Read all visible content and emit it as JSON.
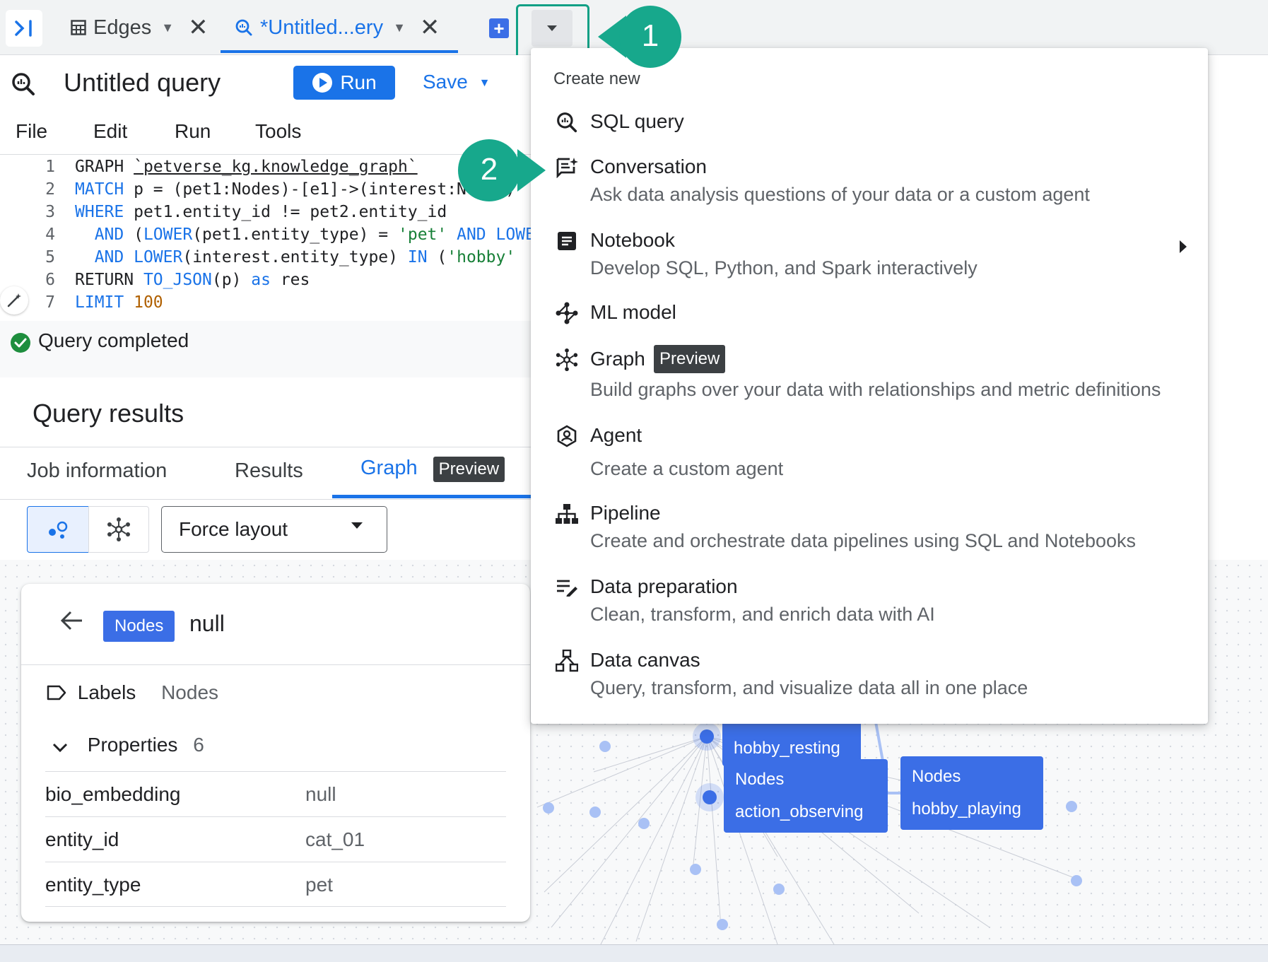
{
  "tabs": {
    "edges_label": "Edges",
    "query_label": "*Untitled...ery"
  },
  "query": {
    "title": "Untitled query",
    "run_label": "Run",
    "save_label": "Save",
    "menu": [
      "File",
      "Edit",
      "Run",
      "Tools"
    ]
  },
  "editor": {
    "line_numbers": [
      "1",
      "2",
      "3",
      "4",
      "5",
      "6",
      "7"
    ]
  },
  "status": {
    "text": "Query completed"
  },
  "results": {
    "title": "Query results",
    "tabs": [
      "Job information",
      "Results",
      "Graph"
    ],
    "preview_badge": "Preview",
    "layout_select": "Force layout"
  },
  "panel": {
    "badge": "Nodes",
    "name": "null",
    "labels_key": "Labels",
    "labels_value": "Nodes",
    "properties_label": "Properties",
    "properties_count": "6",
    "properties": [
      {
        "key": "bio_embedding",
        "value": "null"
      },
      {
        "key": "entity_id",
        "value": "cat_01"
      },
      {
        "key": "entity_type",
        "value": "pet"
      }
    ]
  },
  "graph_nodes": {
    "n1_type": "Nodes",
    "n1_name": "hobby_resting",
    "n2_type": "Nodes",
    "n2_name": "action_observing",
    "n3_type": "Nodes",
    "n3_name": "hobby_playing"
  },
  "callouts": {
    "one": "1",
    "two": "2"
  },
  "dropdown_menu": {
    "heading": "Create new",
    "items": [
      {
        "title": "SQL query",
        "desc": "",
        "icon": "sql-query-icon"
      },
      {
        "title": "Conversation",
        "desc": "Ask data analysis questions of your data or a custom agent",
        "icon": "conversation-icon"
      },
      {
        "title": "Notebook",
        "desc": "Develop SQL, Python, and Spark interactively",
        "icon": "notebook-icon"
      },
      {
        "title": "ML model",
        "desc": "",
        "icon": "ml-model-icon"
      },
      {
        "title": "Graph",
        "desc": "Build graphs over your data with relationships and metric definitions",
        "icon": "graph-icon",
        "badge": "Preview"
      },
      {
        "title": "Agent",
        "desc": "Create a custom agent",
        "icon": "agent-icon"
      },
      {
        "title": "Pipeline",
        "desc": "Create and orchestrate data pipelines using SQL and Notebooks",
        "icon": "pipeline-icon"
      },
      {
        "title": "Data preparation",
        "desc": "Clean, transform, and enrich data with AI",
        "icon": "data-preparation-icon"
      },
      {
        "title": "Data canvas",
        "desc": "Query, transform, and visualize data all in one place",
        "icon": "data-canvas-icon"
      }
    ]
  },
  "colors": {
    "accent": "#1a73e8",
    "node_fill": "#3b6ee6",
    "callout": "#17a88c",
    "success": "#1e8e3e"
  }
}
